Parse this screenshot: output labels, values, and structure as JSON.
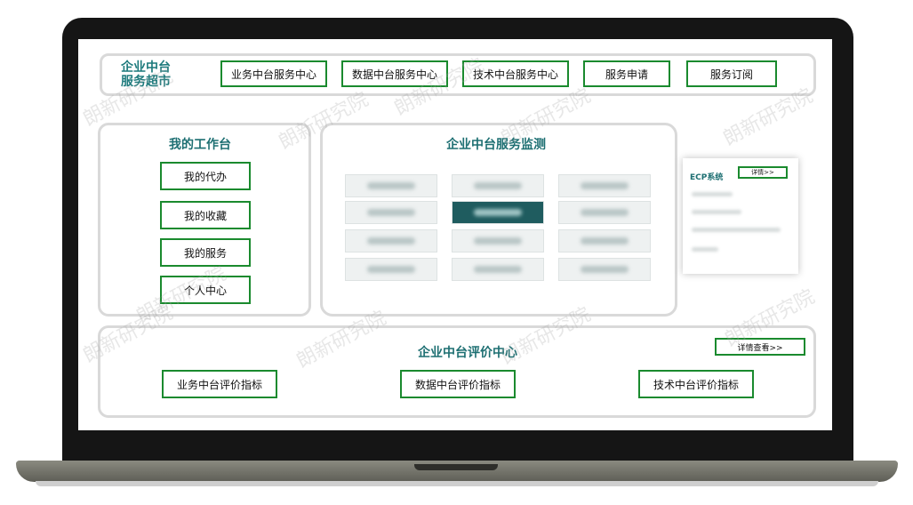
{
  "brand": {
    "line1": "企业中台",
    "line2": "服务超市"
  },
  "nav": [
    {
      "label": "业务中台服务中心"
    },
    {
      "label": "数据中台服务中心"
    },
    {
      "label": "技术中台服务中心"
    },
    {
      "label": "服务申请"
    },
    {
      "label": "服务订阅"
    }
  ],
  "workbench": {
    "title": "我的工作台",
    "items": [
      {
        "label": "我的代办"
      },
      {
        "label": "我的收藏"
      },
      {
        "label": "我的服务"
      },
      {
        "label": "个人中心"
      }
    ]
  },
  "monitor": {
    "title": "企业中台服务监测"
  },
  "ecp": {
    "title": "ECP系统",
    "details_label": "详情>>"
  },
  "evaluation": {
    "title": "企业中台评价中心",
    "details_label": "详情查看>>",
    "items": [
      {
        "label": "业务中台评价指标"
      },
      {
        "label": "数据中台评价指标"
      },
      {
        "label": "技术中台评价指标"
      }
    ]
  },
  "watermark": "朗新研究院",
  "colors": {
    "accent_green": "#1a8a2e",
    "title_teal": "#1d6f72",
    "frame": "#151515"
  }
}
